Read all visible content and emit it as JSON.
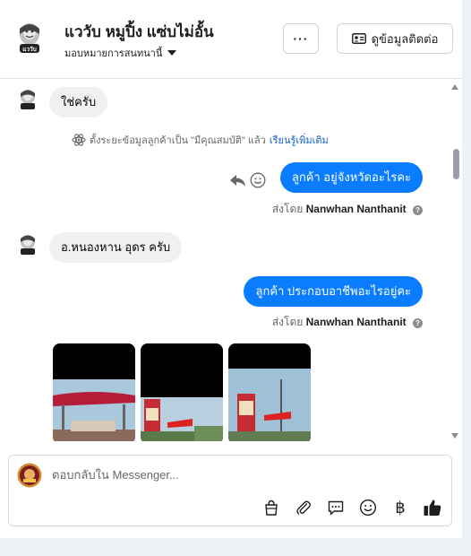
{
  "header": {
    "page_name": "แววับ หมูปิ้ง แซ่บไม่อั้น",
    "assign_label": "มอบหมายการสนทนานี้",
    "more_label": "···",
    "contact_info_label": "ดูข้อมูลติดต่อ",
    "avatar_text": "แววับ"
  },
  "thread": {
    "messages": [
      {
        "direction": "in",
        "text": "ใช่ครับ"
      },
      {
        "direction": "system",
        "text": "ตั้งระยะข้อมูลลูกค้าเป็น \"มีคุณสมบัติ\" แล้ว",
        "link": "เรียนรู้เพิ่มเติม"
      },
      {
        "direction": "out",
        "text": "ลูกค้า  อยู่จังหวัดอะไรคะ",
        "sent_by_prefix": "ส่งโดย",
        "sent_by_name": "Nanwhan Nanthanit"
      },
      {
        "direction": "in",
        "text": "อ.หนองหาน อุดร ครับ"
      },
      {
        "direction": "out",
        "text": "ลูกค้า  ประกอบอาชีพอะไรอยู่คะ",
        "sent_by_prefix": "ส่งโดย",
        "sent_by_name": "Nanwhan Nanthanit"
      }
    ],
    "help_glyph": "?"
  },
  "composer": {
    "placeholder": "ตอบกลับใน Messenger...",
    "tools": [
      "shopping-bag-icon",
      "paperclip-icon",
      "saved-reply-icon",
      "emoji-icon",
      "baht-icon",
      "thumbs-up-icon"
    ],
    "baht_glyph": "฿"
  },
  "colors": {
    "accent": "#0a7cff",
    "incoming_bubble": "#f0f0f0",
    "link": "#1662c5",
    "secondary_text": "#65676b"
  }
}
